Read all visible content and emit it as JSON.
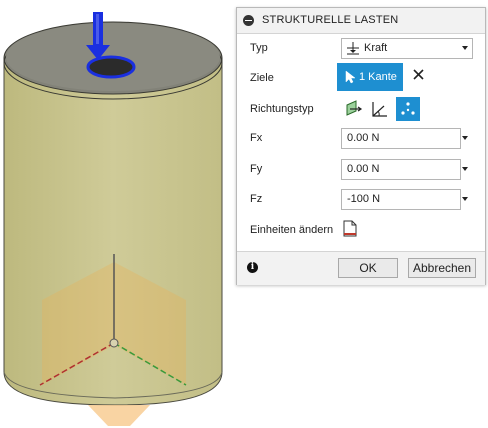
{
  "dialog": {
    "title": "STRUKTURELLE LASTEN",
    "typ": {
      "label": "Typ",
      "value": "Kraft",
      "icon": "force-icon"
    },
    "ziele": {
      "label": "Ziele",
      "selection": "1 Kante",
      "clear_icon": "close-icon"
    },
    "richtungstyp": {
      "label": "Richtungstyp",
      "icons": [
        "normal-direction-icon",
        "angle-direction-icon",
        "vector-components-icon"
      ],
      "active": 2
    },
    "fx": {
      "label": "Fx",
      "value": "0.00 N"
    },
    "fy": {
      "label": "Fy",
      "value": "0.00 N"
    },
    "fz": {
      "label": "Fz",
      "value": "-100 N"
    },
    "units": {
      "label": "Einheiten ändern",
      "icon": "units-doc-icon"
    },
    "ok": "OK",
    "cancel": "Abbrechen",
    "info_icon": "info-icon"
  },
  "colors": {
    "accent": "#1e8fd1",
    "cylinder": "#c8c492",
    "cylinder_top": "#8a8a80",
    "load_arrow": "#1a2fe0"
  }
}
